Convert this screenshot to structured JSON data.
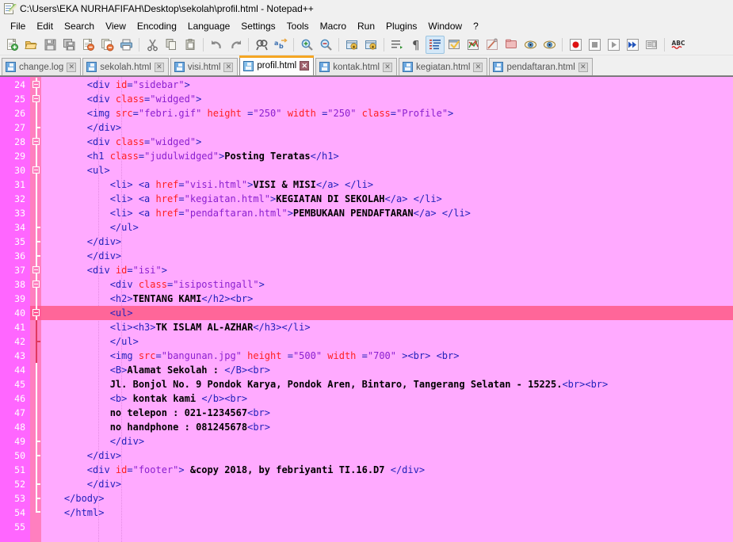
{
  "window": {
    "title": "C:\\Users\\EKA NURHAFIFAH\\Desktop\\sekolah\\profil.html - Notepad++",
    "app_icon": "notepad-plus-plus-icon"
  },
  "menu": {
    "items": [
      {
        "label": "File"
      },
      {
        "label": "Edit"
      },
      {
        "label": "Search"
      },
      {
        "label": "View"
      },
      {
        "label": "Encoding"
      },
      {
        "label": "Language"
      },
      {
        "label": "Settings"
      },
      {
        "label": "Tools"
      },
      {
        "label": "Macro"
      },
      {
        "label": "Run"
      },
      {
        "label": "Plugins"
      },
      {
        "label": "Window"
      },
      {
        "label": "?"
      }
    ]
  },
  "toolbar": {
    "buttons": [
      {
        "name": "new-file-icon"
      },
      {
        "name": "open-file-icon"
      },
      {
        "name": "save-icon"
      },
      {
        "name": "save-all-icon"
      },
      {
        "name": "close-file-icon"
      },
      {
        "name": "close-all-icon"
      },
      {
        "name": "print-icon"
      },
      {
        "name": "separator"
      },
      {
        "name": "cut-icon"
      },
      {
        "name": "copy-icon"
      },
      {
        "name": "paste-icon"
      },
      {
        "name": "separator"
      },
      {
        "name": "undo-icon"
      },
      {
        "name": "redo-icon"
      },
      {
        "name": "separator"
      },
      {
        "name": "find-icon"
      },
      {
        "name": "replace-icon"
      },
      {
        "name": "separator"
      },
      {
        "name": "zoom-in-icon"
      },
      {
        "name": "zoom-out-icon"
      },
      {
        "name": "separator"
      },
      {
        "name": "sync-vertical-scroll-icon"
      },
      {
        "name": "sync-horizontal-scroll-icon"
      },
      {
        "name": "separator"
      },
      {
        "name": "word-wrap-icon"
      },
      {
        "name": "show-all-characters-icon"
      },
      {
        "name": "indent-guide-icon"
      },
      {
        "name": "user-defined-dialog-icon"
      },
      {
        "name": "show-symbol-icon"
      },
      {
        "name": "document-map-icon"
      },
      {
        "name": "function-list-icon"
      },
      {
        "name": "folder-as-workspace-icon"
      },
      {
        "name": "monitoring-icon"
      },
      {
        "name": "separator"
      },
      {
        "name": "record-macro-icon"
      },
      {
        "name": "stop-recording-icon"
      },
      {
        "name": "play-macro-icon"
      },
      {
        "name": "run-macro-multiple-icon"
      },
      {
        "name": "save-macro-icon"
      },
      {
        "name": "separator"
      },
      {
        "name": "spell-check-icon"
      }
    ]
  },
  "tabs": [
    {
      "label": "change.log",
      "active": false
    },
    {
      "label": "sekolah.html",
      "active": false
    },
    {
      "label": "visi.html",
      "active": false
    },
    {
      "label": "profil.html",
      "active": true
    },
    {
      "label": "kontak.html",
      "active": false
    },
    {
      "label": "kegiatan.html",
      "active": false
    },
    {
      "label": "pendaftaran.html",
      "active": false
    }
  ],
  "editor": {
    "current_line": 40,
    "first_line": 24,
    "last_line": 55,
    "colors": {
      "background": "#ffaaff",
      "line_number_background": "#ff66ff",
      "fold_column_background": "#ff7fbf",
      "current_line_highlight": "#ff6699",
      "tag": "#2222bb",
      "attribute": "#ff2020",
      "attribute_value": "#8b1fcf",
      "text": "#000000"
    },
    "lines": [
      {
        "n": 24,
        "indent": 8,
        "tokens": [
          {
            "t": "tag",
            "v": "<div "
          },
          {
            "t": "attr",
            "v": "id"
          },
          {
            "t": "tag",
            "v": "="
          },
          {
            "t": "val",
            "v": "\"sidebar\""
          },
          {
            "t": "tag",
            "v": ">"
          }
        ]
      },
      {
        "n": 25,
        "indent": 8,
        "tokens": [
          {
            "t": "tag",
            "v": "<div "
          },
          {
            "t": "attr",
            "v": "class"
          },
          {
            "t": "tag",
            "v": "="
          },
          {
            "t": "val",
            "v": "\"widged\""
          },
          {
            "t": "tag",
            "v": ">"
          }
        ]
      },
      {
        "n": 26,
        "indent": 8,
        "tokens": [
          {
            "t": "tag",
            "v": "<img "
          },
          {
            "t": "attr",
            "v": "src"
          },
          {
            "t": "tag",
            "v": "="
          },
          {
            "t": "val",
            "v": "\"febri.gif\""
          },
          {
            "t": "attr",
            "v": " height "
          },
          {
            "t": "tag",
            "v": "="
          },
          {
            "t": "val",
            "v": "\"250\""
          },
          {
            "t": "attr",
            "v": " width "
          },
          {
            "t": "tag",
            "v": "="
          },
          {
            "t": "val",
            "v": "\"250\""
          },
          {
            "t": "attr",
            "v": " class"
          },
          {
            "t": "tag",
            "v": "="
          },
          {
            "t": "val",
            "v": "\"Profile\""
          },
          {
            "t": "tag",
            "v": ">"
          }
        ]
      },
      {
        "n": 27,
        "indent": 8,
        "tokens": [
          {
            "t": "tag",
            "v": "</div>"
          }
        ]
      },
      {
        "n": 28,
        "indent": 8,
        "tokens": [
          {
            "t": "tag",
            "v": "<div "
          },
          {
            "t": "attr",
            "v": "class"
          },
          {
            "t": "tag",
            "v": "="
          },
          {
            "t": "val",
            "v": "\"widged\""
          },
          {
            "t": "tag",
            "v": ">"
          }
        ]
      },
      {
        "n": 29,
        "indent": 8,
        "tokens": [
          {
            "t": "tag",
            "v": "<h1 "
          },
          {
            "t": "attr",
            "v": "class"
          },
          {
            "t": "tag",
            "v": "="
          },
          {
            "t": "val",
            "v": "\"judulwidged\""
          },
          {
            "t": "tag",
            "v": ">"
          },
          {
            "t": "txt",
            "v": "Posting Teratas"
          },
          {
            "t": "tag",
            "v": "</h1>"
          }
        ]
      },
      {
        "n": 30,
        "indent": 8,
        "tokens": [
          {
            "t": "tag",
            "v": "<ul>"
          }
        ]
      },
      {
        "n": 31,
        "indent": 12,
        "tokens": [
          {
            "t": "tag",
            "v": "<li> <a "
          },
          {
            "t": "attr",
            "v": "href"
          },
          {
            "t": "tag",
            "v": "="
          },
          {
            "t": "val",
            "v": "\"visi.html\""
          },
          {
            "t": "tag",
            "v": ">"
          },
          {
            "t": "txt",
            "v": "VISI & MISI"
          },
          {
            "t": "tag",
            "v": "</a> </li>"
          }
        ]
      },
      {
        "n": 32,
        "indent": 12,
        "tokens": [
          {
            "t": "tag",
            "v": "<li> <a "
          },
          {
            "t": "attr",
            "v": "href"
          },
          {
            "t": "tag",
            "v": "="
          },
          {
            "t": "val",
            "v": "\"kegiatan.html\""
          },
          {
            "t": "tag",
            "v": ">"
          },
          {
            "t": "txt",
            "v": "KEGIATAN DI SEKOLAH"
          },
          {
            "t": "tag",
            "v": "</a> </li>"
          }
        ]
      },
      {
        "n": 33,
        "indent": 12,
        "tokens": [
          {
            "t": "tag",
            "v": "<li> <a "
          },
          {
            "t": "attr",
            "v": "href"
          },
          {
            "t": "tag",
            "v": "="
          },
          {
            "t": "val",
            "v": "\"pendaftaran.html\""
          },
          {
            "t": "tag",
            "v": ">"
          },
          {
            "t": "txt",
            "v": "PEMBUKAAN PENDAFTARAN"
          },
          {
            "t": "tag",
            "v": "</a> </li>"
          }
        ]
      },
      {
        "n": 34,
        "indent": 12,
        "tokens": [
          {
            "t": "tag",
            "v": "</ul>"
          }
        ]
      },
      {
        "n": 35,
        "indent": 8,
        "tokens": [
          {
            "t": "tag",
            "v": "</div>"
          }
        ]
      },
      {
        "n": 36,
        "indent": 8,
        "tokens": [
          {
            "t": "tag",
            "v": "</div>"
          }
        ]
      },
      {
        "n": 37,
        "indent": 8,
        "tokens": [
          {
            "t": "tag",
            "v": "<div "
          },
          {
            "t": "attr",
            "v": "id"
          },
          {
            "t": "tag",
            "v": "="
          },
          {
            "t": "val",
            "v": "\"isi\""
          },
          {
            "t": "tag",
            "v": ">"
          }
        ]
      },
      {
        "n": 38,
        "indent": 12,
        "tokens": [
          {
            "t": "tag",
            "v": "<div "
          },
          {
            "t": "attr",
            "v": "class"
          },
          {
            "t": "tag",
            "v": "="
          },
          {
            "t": "val",
            "v": "\"isipostingall\""
          },
          {
            "t": "tag",
            "v": ">"
          }
        ]
      },
      {
        "n": 39,
        "indent": 12,
        "tokens": [
          {
            "t": "tag",
            "v": "<h2>"
          },
          {
            "t": "txt",
            "v": "TENTANG KAMI"
          },
          {
            "t": "tag",
            "v": "</h2><br>"
          }
        ]
      },
      {
        "n": 40,
        "indent": 12,
        "tokens": [
          {
            "t": "tag",
            "v": "<ul>"
          }
        ]
      },
      {
        "n": 41,
        "indent": 12,
        "tokens": [
          {
            "t": "tag",
            "v": "<li><h3>"
          },
          {
            "t": "txt",
            "v": "TK ISLAM AL-AZHAR"
          },
          {
            "t": "tag",
            "v": "</h3></li>"
          }
        ]
      },
      {
        "n": 42,
        "indent": 12,
        "tokens": [
          {
            "t": "tag",
            "v": "</ul>"
          }
        ]
      },
      {
        "n": 43,
        "indent": 12,
        "tokens": [
          {
            "t": "tag",
            "v": "<img "
          },
          {
            "t": "attr",
            "v": "src"
          },
          {
            "t": "tag",
            "v": "="
          },
          {
            "t": "val",
            "v": "\"bangunan.jpg\""
          },
          {
            "t": "attr",
            "v": " height "
          },
          {
            "t": "tag",
            "v": "="
          },
          {
            "t": "val",
            "v": "\"500\""
          },
          {
            "t": "attr",
            "v": " width "
          },
          {
            "t": "tag",
            "v": "="
          },
          {
            "t": "val",
            "v": "\"700\""
          },
          {
            "t": "tag",
            "v": " ><br> <br>"
          }
        ]
      },
      {
        "n": 44,
        "indent": 12,
        "tokens": [
          {
            "t": "tag",
            "v": "<B>"
          },
          {
            "t": "txt",
            "v": "Alamat Sekolah : "
          },
          {
            "t": "tag",
            "v": "</B><br>"
          }
        ]
      },
      {
        "n": 45,
        "indent": 12,
        "tokens": [
          {
            "t": "txt",
            "v": "Jl. Bonjol No. 9 Pondok Karya, Pondok Aren, Bintaro, Tangerang Selatan - 15225."
          },
          {
            "t": "tag",
            "v": "<br><br>"
          }
        ]
      },
      {
        "n": 46,
        "indent": 12,
        "tokens": [
          {
            "t": "tag",
            "v": "<b>"
          },
          {
            "t": "txt",
            "v": " kontak kami "
          },
          {
            "t": "tag",
            "v": "</b><br>"
          }
        ]
      },
      {
        "n": 47,
        "indent": 12,
        "tokens": [
          {
            "t": "txt",
            "v": "no telepon : 021-1234567"
          },
          {
            "t": "tag",
            "v": "<br>"
          }
        ]
      },
      {
        "n": 48,
        "indent": 12,
        "tokens": [
          {
            "t": "txt",
            "v": "no handphone : 081245678"
          },
          {
            "t": "tag",
            "v": "<br>"
          }
        ]
      },
      {
        "n": 49,
        "indent": 12,
        "tokens": [
          {
            "t": "tag",
            "v": "</div>"
          }
        ]
      },
      {
        "n": 50,
        "indent": 8,
        "tokens": [
          {
            "t": "tag",
            "v": "</div>"
          }
        ]
      },
      {
        "n": 51,
        "indent": 8,
        "tokens": [
          {
            "t": "tag",
            "v": "<div "
          },
          {
            "t": "attr",
            "v": "id"
          },
          {
            "t": "tag",
            "v": "="
          },
          {
            "t": "val",
            "v": "\"footer\""
          },
          {
            "t": "tag",
            "v": "> "
          },
          {
            "t": "txt",
            "v": "&copy 2018, by febriyanti TI.16.D7 "
          },
          {
            "t": "tag",
            "v": "</div>"
          }
        ]
      },
      {
        "n": 52,
        "indent": 8,
        "tokens": [
          {
            "t": "tag",
            "v": "</div>"
          }
        ]
      },
      {
        "n": 53,
        "indent": 4,
        "tokens": [
          {
            "t": "tag",
            "v": "</body>"
          }
        ]
      },
      {
        "n": 54,
        "indent": 4,
        "tokens": [
          {
            "t": "tag",
            "v": "</html>"
          }
        ]
      },
      {
        "n": 55,
        "indent": 0,
        "tokens": []
      }
    ]
  }
}
